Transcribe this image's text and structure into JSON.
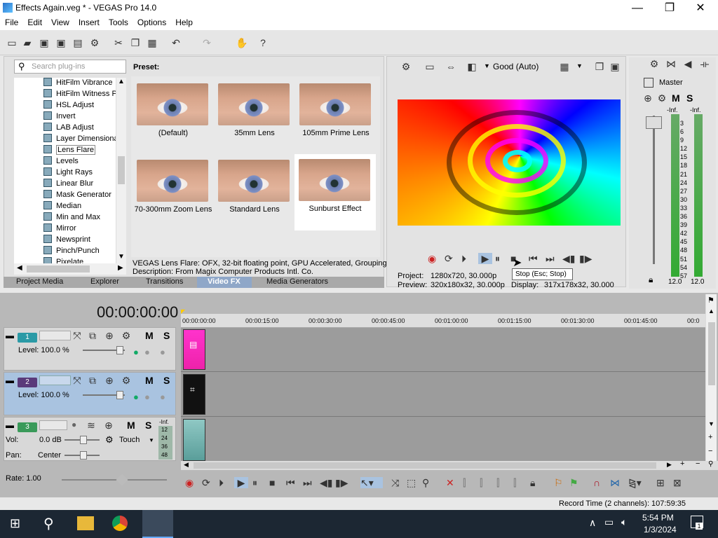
{
  "window": {
    "title": "Effects Again.veg * - VEGAS Pro 14.0",
    "min": "—",
    "max": "❐",
    "close": "✕"
  },
  "menu": [
    "File",
    "Edit",
    "View",
    "Insert",
    "Tools",
    "Options",
    "Help"
  ],
  "plugins": {
    "search_placeholder": "Search plug-ins",
    "items": [
      "HitFilm Vibrance",
      "HitFilm Witness P",
      "HSL Adjust",
      "Invert",
      "LAB Adjust",
      "Layer Dimensiona",
      "Lens Flare",
      "Levels",
      "Light Rays",
      "Linear Blur",
      "Mask Generator",
      "Median",
      "Min and Max",
      "Mirror",
      "Newsprint",
      "Pinch/Punch",
      "Pixelate"
    ],
    "selected": "Lens Flare"
  },
  "preset": {
    "header": "Preset:",
    "items": [
      "(Default)",
      "35mm Lens",
      "105mm Prime Lens",
      "70-300mm Zoom Lens",
      "Standard Lens",
      "Sunburst Effect"
    ],
    "selected": "Sunburst Effect",
    "desc1": "VEGAS Lens Flare: OFX, 32-bit floating point, GPU Accelerated, Grouping",
    "desc2": "Description: From Magix Computer Products Intl. Co."
  },
  "tabs": [
    "Project Media",
    "Explorer",
    "Transitions",
    "Video FX",
    "Media Generators"
  ],
  "active_tab": "Video FX",
  "preview": {
    "quality": "Good (Auto)",
    "project_label": "Project:",
    "project_value": "1280x720, 30.000p",
    "preview_label": "Preview:",
    "preview_value": "320x180x32, 30.000p",
    "display_label": "Display:",
    "display_value": "317x178x32, 30.000",
    "tooltip": "Stop (Esc; Stop)"
  },
  "mixer": {
    "title": "Master",
    "m": "M",
    "s": "S",
    "inf1": "-Inf.",
    "inf2": "-Inf.",
    "scale": [
      "3",
      "6",
      "9",
      "12",
      "15",
      "18",
      "21",
      "24",
      "27",
      "30",
      "33",
      "36",
      "39",
      "42",
      "45",
      "48",
      "51",
      "54",
      "57"
    ],
    "bottom1": "12.0",
    "bottom2": "12.0"
  },
  "timecode": "00:00:00:00",
  "tracks": [
    {
      "num": "1",
      "level": "Level: 100.0 %",
      "m": "M",
      "s": "S"
    },
    {
      "num": "2",
      "level": "Level: 100.0 %",
      "m": "M",
      "s": "S"
    },
    {
      "num": "3",
      "vol_label": "Vol:",
      "vol": "0.0 dB",
      "pan_label": "Pan:",
      "pan": "Center",
      "touch": "Touch",
      "m": "M",
      "s": "S",
      "inf": "-Inf.",
      "meter": [
        "12",
        "24",
        "36",
        "48"
      ]
    }
  ],
  "ruler": [
    "00:00:00:00",
    "00:00:15:00",
    "00:00:30:00",
    "00:00:45:00",
    "00:01:00:00",
    "00:01:15:00",
    "00:01:30:00",
    "00:01:45:00",
    "00:0"
  ],
  "rate": "Rate: 1.00",
  "status": "Record Time (2 channels): 107:59:35",
  "taskbar": {
    "time": "5:54 PM",
    "date": "1/3/2024",
    "notifications": "1"
  },
  "colors": {
    "selected_track": "#a9c3e0",
    "active_tab": "#3d7fd4",
    "taskbar": "#1c2733"
  }
}
